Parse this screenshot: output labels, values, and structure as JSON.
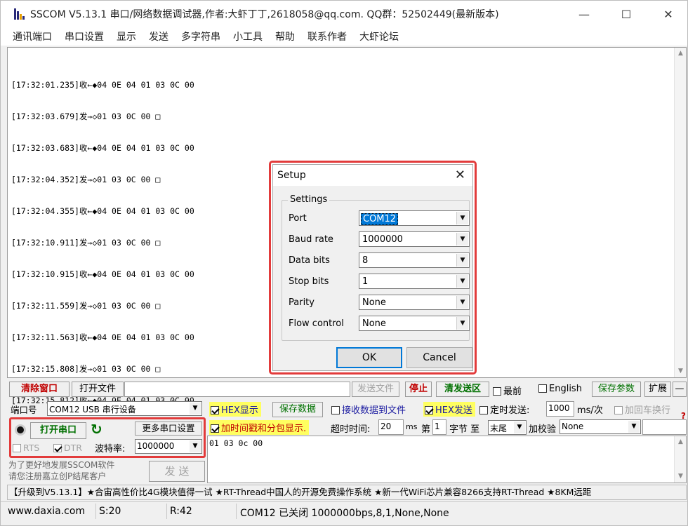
{
  "window": {
    "title": "SSCOM V5.13.1 串口/网络数据调试器,作者:大虾丁丁,2618058@qq.com. QQ群：52502449(最新版本)",
    "controls": {
      "minimize": "—",
      "maximize": "☐",
      "close": "✕"
    }
  },
  "menu": [
    "通讯端口",
    "串口设置",
    "显示",
    "发送",
    "多字符串",
    "小工具",
    "帮助",
    "联系作者",
    "大虾论坛"
  ],
  "receive_log": [
    "[17:32:01.235]收←◆04 0E 04 01 03 0C 00",
    "[17:32:03.679]发→◇01 03 0C 00 □",
    "[17:32:03.683]收←◆04 0E 04 01 03 0C 00",
    "[17:32:04.352]发→◇01 03 0C 00 □",
    "[17:32:04.355]收←◆04 0E 04 01 03 0C 00",
    "[17:32:10.911]发→◇01 03 0C 00 □",
    "[17:32:10.915]收←◆04 0E 04 01 03 0C 00",
    "[17:32:11.559]发→◇01 03 0C 00 □",
    "[17:32:11.563]收←◆04 0E 04 01 03 0C 00",
    "[17:32:15.808]发→◇01 03 0C 00 □",
    "[17:32:15.812]收←◆04 0E 04 01 03 0C 00"
  ],
  "setup": {
    "title": "Setup",
    "close": "✕",
    "group": "Settings",
    "fields": {
      "port": {
        "label": "Port",
        "value": "COM12"
      },
      "baud": {
        "label": "Baud rate",
        "value": "1000000"
      },
      "databits": {
        "label": "Data bits",
        "value": "8"
      },
      "stopbits": {
        "label": "Stop bits",
        "value": "1"
      },
      "parity": {
        "label": "Parity",
        "value": "None"
      },
      "flow": {
        "label": "Flow control",
        "value": "None"
      }
    },
    "ok": "OK",
    "cancel": "Cancel"
  },
  "toolbar1": {
    "clear": "清除窗口",
    "open_file": "打开文件",
    "send_file": "发送文件",
    "stop": "停止",
    "clear_send": "清发送区",
    "topmost": "最前",
    "english": "English",
    "save_params": "保存参数",
    "expand": "扩展",
    "collapse": "—"
  },
  "row2": {
    "port_label": "端口号",
    "port_value": "COM12 USB 串行设备",
    "hex_display": "HEX显示",
    "save_data": "保存数据",
    "recv_to_file": "接收数据到文件",
    "hex_send": "HEX发送",
    "timed_send": "定时发送:",
    "interval": "1000",
    "interval_unit": "ms/次",
    "add_crlf": "加回车换行",
    "help_mark": "?"
  },
  "row3": {
    "open_port": "打开串口",
    "more_settings": "更多串口设置",
    "timestamp": "加时间戳和分包显示.",
    "timeout_label": "超时时间:",
    "timeout": "20",
    "timeout_unit": "ms",
    "byte_prefix": "第",
    "byte_start": "1",
    "byte_mid": "字节 至",
    "byte_end": "末尾",
    "checksum_label": "加校验",
    "checksum": "None"
  },
  "row4": {
    "rts": "RTS",
    "dtr": "DTR",
    "baud_label": "波特率:",
    "baud": "1000000"
  },
  "send_text": "01 03 0c 00",
  "promo": {
    "line1": "为了更好地发展SSCOM软件",
    "line2": "请您注册嘉立创P结尾客户",
    "send_button": "发 送"
  },
  "ticker": "【升级到V5.13.1】★合宙高性价比4G模块值得一试 ★RT-Thread中国人的开源免费操作系统 ★新一代WiFi芯片兼容8266支持RT-Thread ★8KM远距",
  "statusbar": {
    "site": "www.daxia.com",
    "sent": "S:20",
    "received": "R:42",
    "port_status": "COM12 已关闭  1000000bps,8,1,None,None"
  },
  "colors": {
    "highlight_border": "#e23b3b",
    "accent": "#0078d7"
  }
}
